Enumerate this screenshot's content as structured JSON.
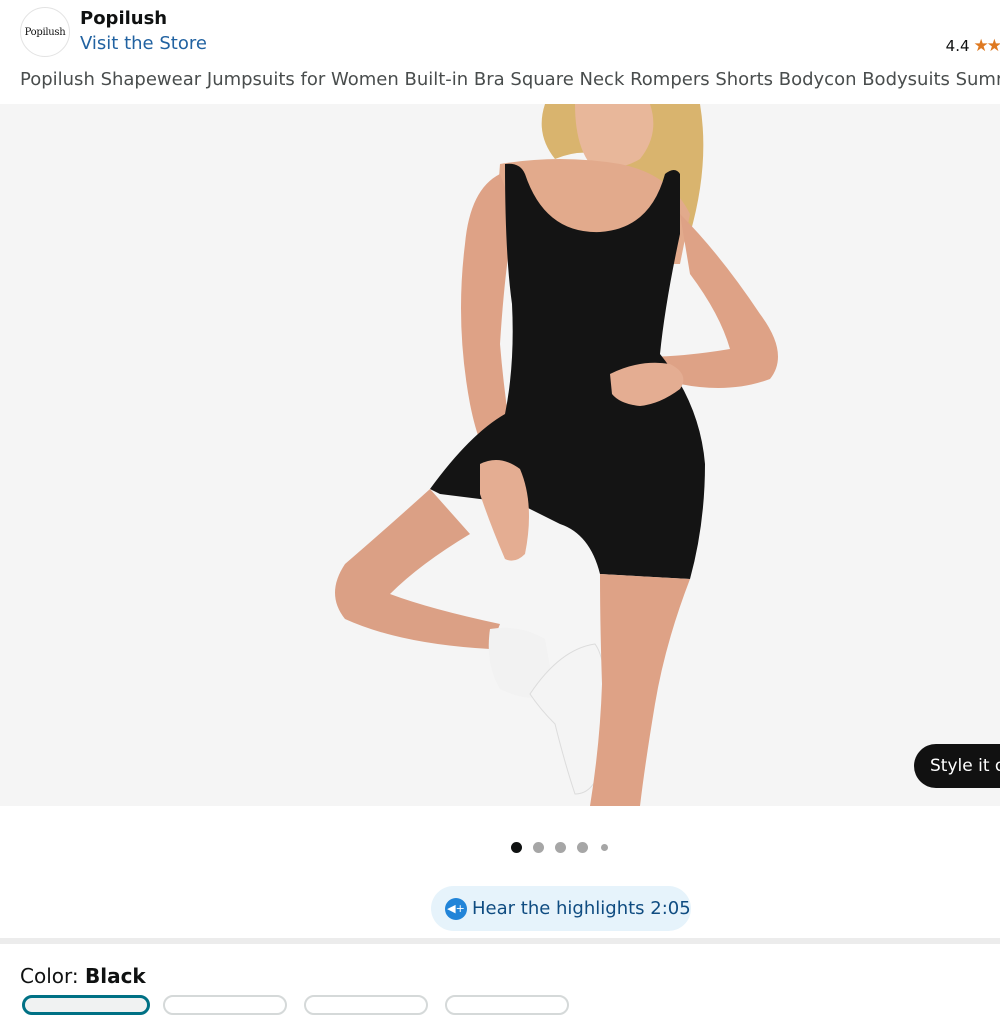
{
  "header": {
    "logo_text": "Popilush",
    "brand_name": "Popilush",
    "visit_store": "Visit the Store",
    "rating_value": "4.4",
    "rating_stars": "★★",
    "rating_color": "#de7921"
  },
  "product": {
    "title": "Popilush Shapewear Jumpsuits for Women Built-in Bra Square Neck Rompers Shorts Bodycon Bodysuits Summer Outfits",
    "style_it_label": "Style it on"
  },
  "carousel": {
    "current_index": 1,
    "total_dots": 5
  },
  "audio": {
    "icon": "speaker-icon",
    "label": "Hear the highlights 2:05"
  },
  "color_selector": {
    "label": "Color: ",
    "selected": "Black",
    "selected_color": "#007185"
  },
  "colors": {
    "link": "#2162a1",
    "image_bg": "#f5f5f5"
  }
}
